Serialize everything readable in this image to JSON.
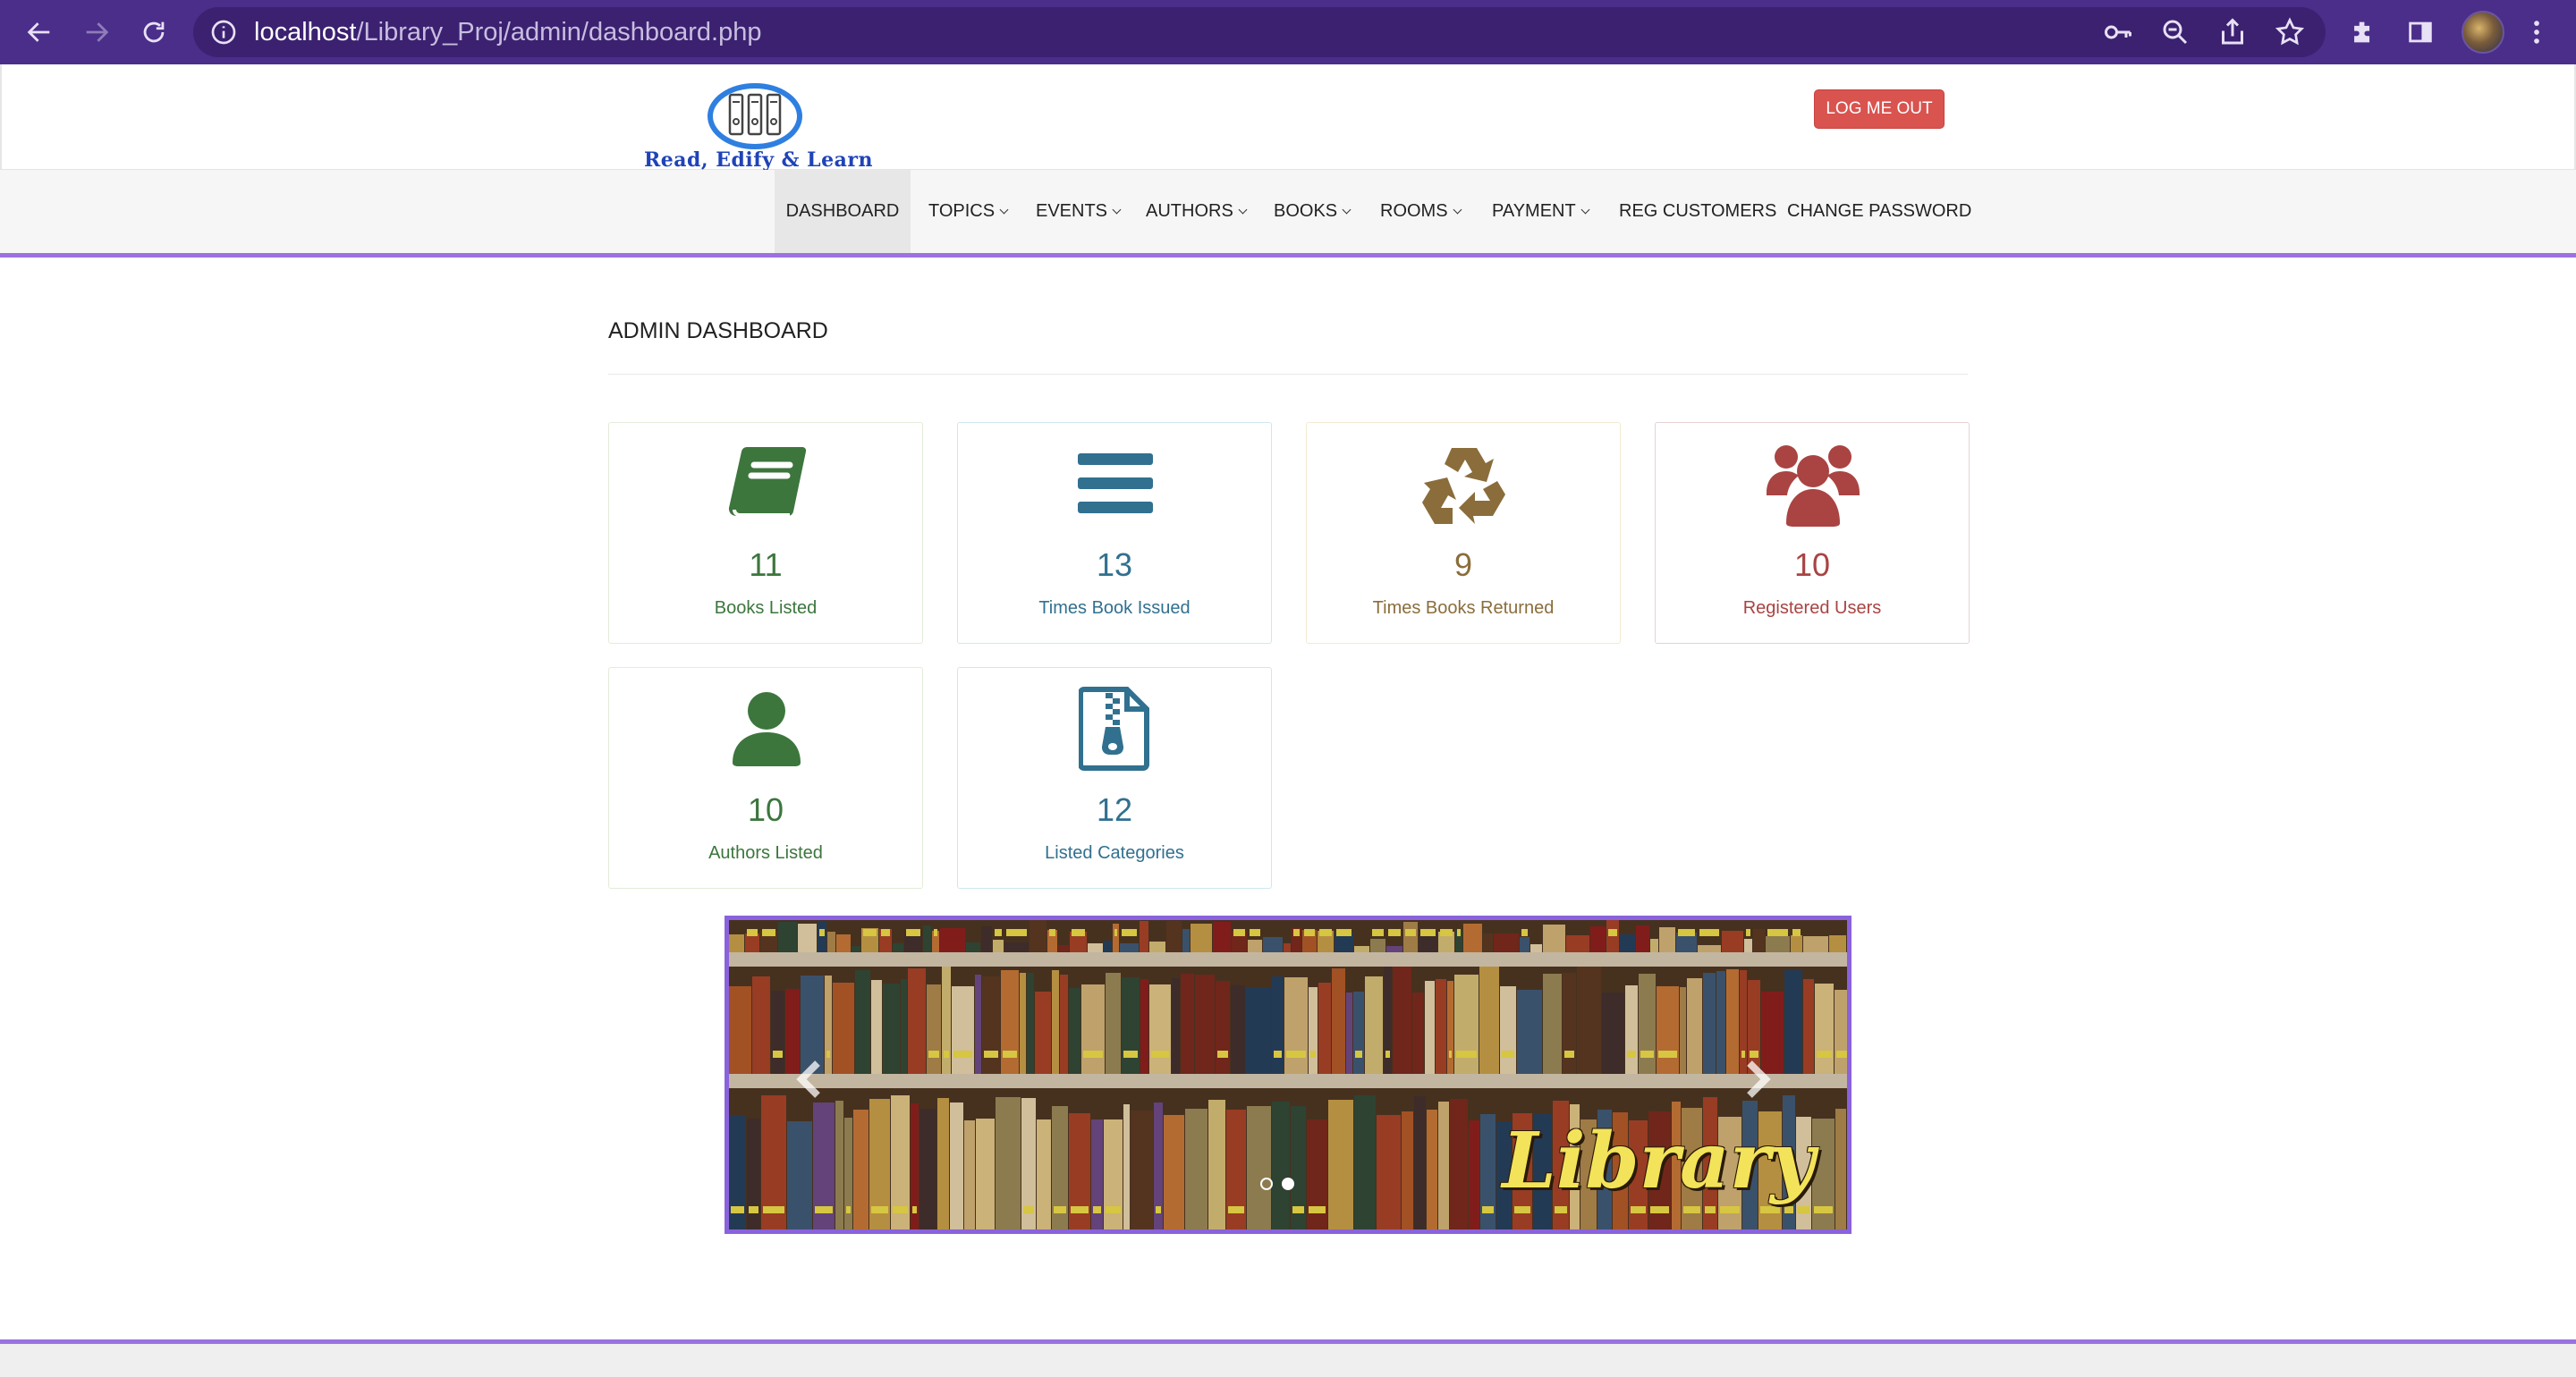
{
  "browser": {
    "url_host": "localhost",
    "url_path": "/Library_Proj/admin/dashboard.php"
  },
  "header": {
    "logo_text": "Read, Edify & Learn",
    "logout_label": "LOG ME OUT"
  },
  "nav": {
    "items": [
      {
        "label": "DASHBOARD",
        "dropdown": false,
        "active": true
      },
      {
        "label": "TOPICS",
        "dropdown": true
      },
      {
        "label": "EVENTS",
        "dropdown": true
      },
      {
        "label": "AUTHORS",
        "dropdown": true
      },
      {
        "label": "BOOKS",
        "dropdown": true
      },
      {
        "label": "ROOMS",
        "dropdown": true
      },
      {
        "label": "PAYMENT",
        "dropdown": true
      },
      {
        "label": "REG CUSTOMERS",
        "dropdown": false
      },
      {
        "label": "CHANGE PASSWORD",
        "dropdown": false
      }
    ]
  },
  "main": {
    "heading": "ADMIN DASHBOARD",
    "stats": [
      {
        "value": "11",
        "label": "Books Listed",
        "icon": "book-icon",
        "color": "#3c763d"
      },
      {
        "value": "13",
        "label": "Times Book Issued",
        "icon": "bars-icon",
        "color": "#31708f"
      },
      {
        "value": "9",
        "label": "Times Books Returned",
        "icon": "recycle-icon",
        "color": "#8a6d3b"
      },
      {
        "value": "10",
        "label": "Registered Users",
        "icon": "users-icon",
        "color": "#a94442"
      },
      {
        "value": "10",
        "label": "Authors Listed",
        "icon": "user-icon",
        "color": "#3c763d"
      },
      {
        "value": "12",
        "label": "Listed Categories",
        "icon": "file-zip-icon",
        "color": "#31708f"
      }
    ]
  },
  "carousel": {
    "caption": "Library",
    "slide_count": 2,
    "active_slide": 2
  },
  "colors": {
    "browser_frame": "#4b2d8a",
    "accent_purple": "#9b72e0",
    "logout_red": "#d9534f"
  }
}
